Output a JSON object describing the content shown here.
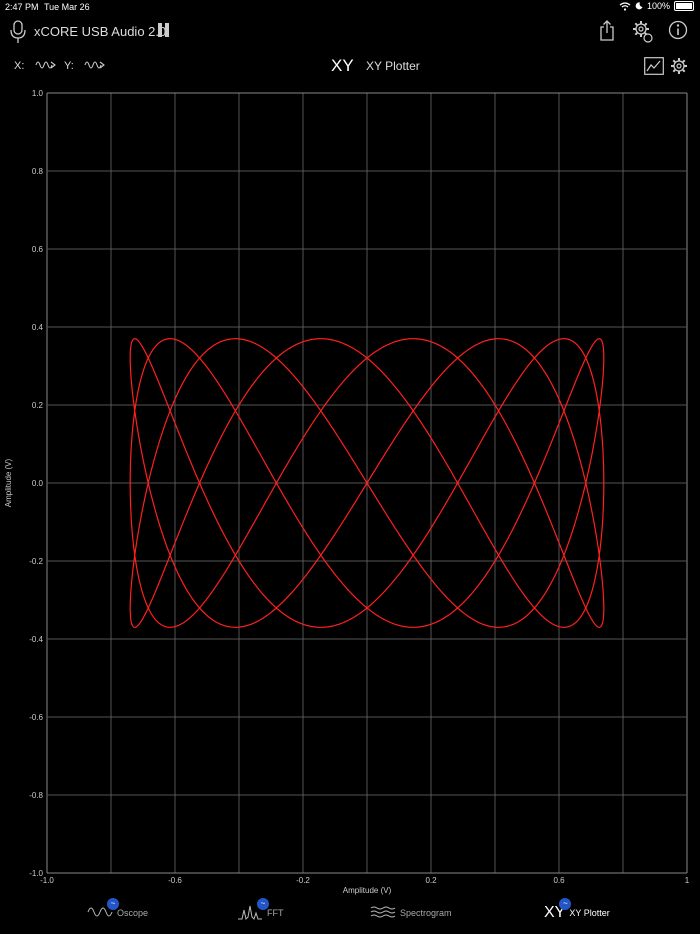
{
  "status": {
    "time": "2:47 PM",
    "date": "Tue Mar 26",
    "battery": "100%"
  },
  "toolbar": {
    "device": "xCORE USB Audio 2.0"
  },
  "axis_select": {
    "x_label": "X:",
    "y_label": "Y:"
  },
  "title": {
    "short": "XY",
    "text": "XY Plotter"
  },
  "chart_data": {
    "type": "line",
    "xlabel": "Amplitude (V)",
    "ylabel": "Amplitude (V)",
    "xlim": [
      -1.0,
      1.0
    ],
    "ylim": [
      -1.0,
      1.0
    ],
    "grid": true,
    "x_ticks": [
      "-1.0",
      "-0.6",
      "-0.2",
      "0.2",
      "0.6",
      "1"
    ],
    "y_ticks": [
      "1.0",
      "0.8",
      "0.6",
      "0.4",
      "0.2",
      "0.0",
      "-0.2",
      "-0.4",
      "-0.6",
      "-0.8",
      "-1.0"
    ],
    "series": [
      {
        "color": "#ff2020",
        "curve": "lissajous",
        "x_amplitude": 0.74,
        "y_amplitude": 0.37,
        "x_freq": 3,
        "y_freq": 8,
        "phase_deg": 45
      }
    ]
  },
  "tabs": [
    {
      "label": "Oscope",
      "icon": "oscope-icon",
      "badge": "~"
    },
    {
      "label": "FFT",
      "icon": "fft-icon",
      "badge": "~"
    },
    {
      "label": "Spectrogram",
      "icon": "spectrogram-icon"
    },
    {
      "label": "XY Plotter",
      "icon": "xy-icon",
      "icon_text": "XY",
      "badge": "~",
      "active": true
    }
  ]
}
